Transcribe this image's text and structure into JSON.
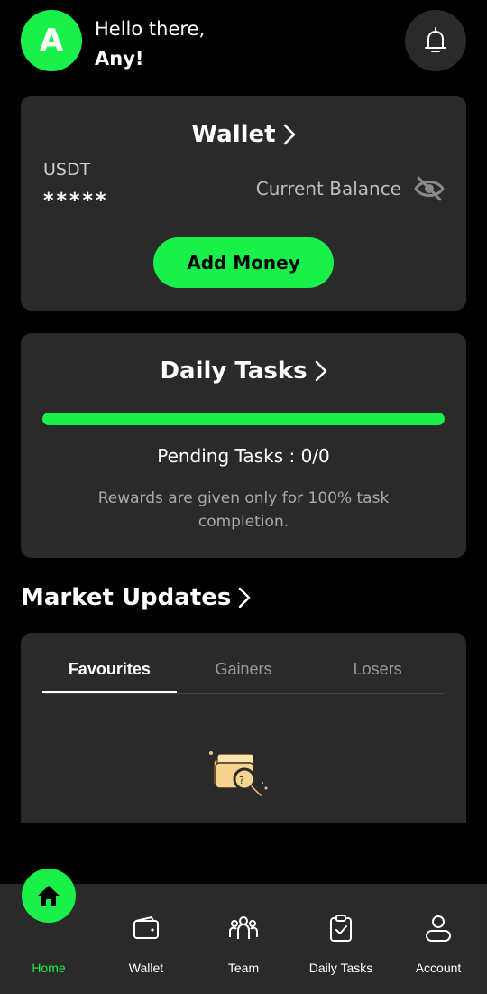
{
  "header": {
    "avatar_letter": "A",
    "greeting": "Hello there,",
    "name": "Any!"
  },
  "wallet": {
    "title": "Wallet",
    "currency": "USDT",
    "masked_balance": "*****",
    "balance_label": "Current Balance",
    "add_money_label": "Add Money"
  },
  "tasks": {
    "title": "Daily Tasks",
    "progress_fraction": 1.0,
    "pending_text": "Pending Tasks : 0/0",
    "note": "Rewards are given only for 100% task completion."
  },
  "market": {
    "title": "Market Updates",
    "tabs": [
      {
        "label": "Favourites",
        "active": true
      },
      {
        "label": "Gainers",
        "active": false
      },
      {
        "label": "Losers",
        "active": false
      }
    ]
  },
  "nav": {
    "items": [
      {
        "label": "Home",
        "icon": "home-icon",
        "active": true
      },
      {
        "label": "Wallet",
        "icon": "wallet-icon",
        "active": false
      },
      {
        "label": "Team",
        "icon": "team-icon",
        "active": false
      },
      {
        "label": "Daily Tasks",
        "icon": "clipboard-check-icon",
        "active": false
      },
      {
        "label": "Account",
        "icon": "user-icon",
        "active": false
      }
    ]
  },
  "colors": {
    "accent": "#19f04a",
    "card": "#2a2a2a",
    "background": "#000000"
  }
}
